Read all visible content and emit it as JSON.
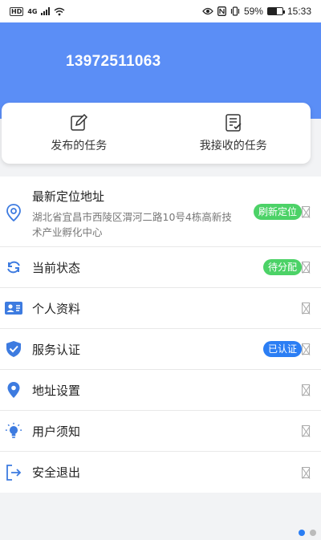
{
  "status_bar": {
    "hd": "HD",
    "network": "4G",
    "battery_percent": "59%",
    "time": "15:33",
    "battery_level": 0.59
  },
  "header": {
    "phone": "13972511063"
  },
  "tasks": {
    "published_label": "发布的任务",
    "received_label": "我接收的任务"
  },
  "menu": {
    "location": {
      "title": "最新定位地址",
      "address": "湖北省宜昌市西陵区渭河二路10号4栋高新技术产业孵化中心",
      "badge": "刷新定位"
    },
    "status": {
      "label": "当前状态",
      "badge": "待分配"
    },
    "profile": {
      "label": "个人资料"
    },
    "certification": {
      "label": "服务认证",
      "badge": "已认证"
    },
    "address_settings": {
      "label": "地址设置"
    },
    "user_notice": {
      "label": "用户须知"
    },
    "logout": {
      "label": "安全退出"
    }
  },
  "colors": {
    "header_blue": "#5b8ef6",
    "icon_blue": "#3d7be0",
    "badge_green": "#4cd267",
    "badge_blue": "#2b7ef4"
  },
  "icons": {
    "published": "edit-icon",
    "received": "checklist-icon",
    "location": "location-pin-icon",
    "status": "refresh-status-icon",
    "profile": "id-card-icon",
    "certification": "shield-check-icon",
    "address_settings": "map-pin-icon",
    "user_notice": "bulb-icon",
    "logout": "exit-icon"
  },
  "pager": {
    "count": 2,
    "active": 0
  }
}
